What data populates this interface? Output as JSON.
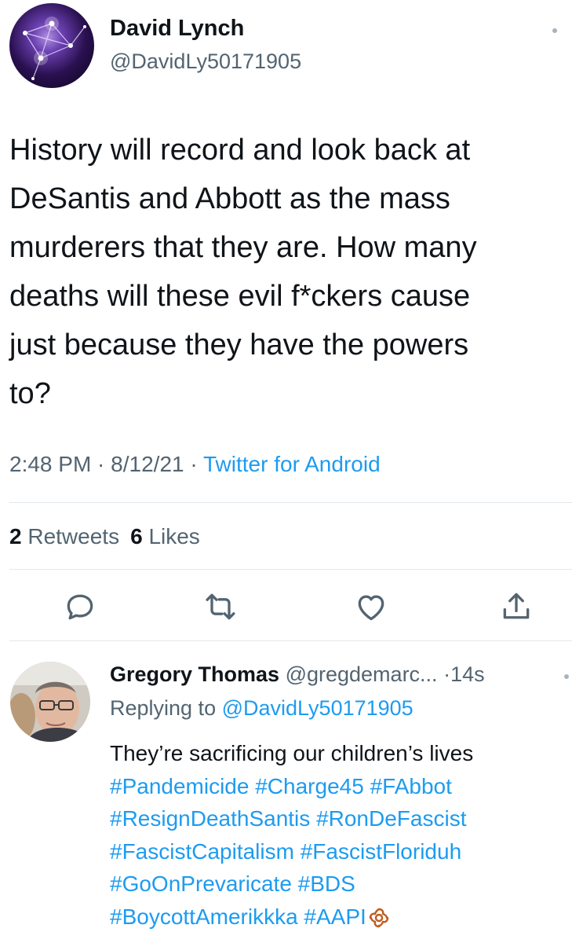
{
  "tweet": {
    "author_name": "David Lynch",
    "author_handle": "@DavidLy50171905",
    "text": "History will record and look back at\nDeSantis and Abbott as the mass\nmurderers that they are. How many\ndeaths will these evil f*ckers cause\njust because they have the powers\nto?",
    "time": "2:48 PM",
    "date": "8/12/21",
    "source": "Twitter for Android",
    "separator": " · ",
    "retweets_count": "2",
    "retweets_label": "Retweets",
    "likes_count": "6",
    "likes_label": "Likes"
  },
  "actions": [
    {
      "name": "reply",
      "icon": "reply-icon"
    },
    {
      "name": "retweet",
      "icon": "retweet-icon"
    },
    {
      "name": "like",
      "icon": "heart-icon"
    },
    {
      "name": "share",
      "icon": "share-icon"
    }
  ],
  "reply": {
    "author_name": "Gregory Thomas",
    "author_handle": "@gregdemarc...",
    "time": "·14s",
    "replying_label": "Replying to",
    "replying_to": "@DavidLy50171905",
    "text": "They’re sacrificing our children’s lives",
    "hashtag_lines": [
      [
        "#Pandemicide",
        "#Charge45",
        "#FAbbot"
      ],
      [
        "#ResignDeathSantis",
        "#RonDeFascist"
      ],
      [
        "#FascistCapitalism",
        "#FascistFloriduh"
      ],
      [
        "#GoOnPrevaricate",
        "#BDS"
      ],
      [
        "#BoycottAmerikkka",
        "#AAPI"
      ]
    ],
    "trailing_emoji": "knot-emoji"
  },
  "colors": {
    "link": "#1d9bf0",
    "secondary_text": "#536471",
    "primary_text": "#0f1419",
    "divider": "#e1e8ed"
  }
}
